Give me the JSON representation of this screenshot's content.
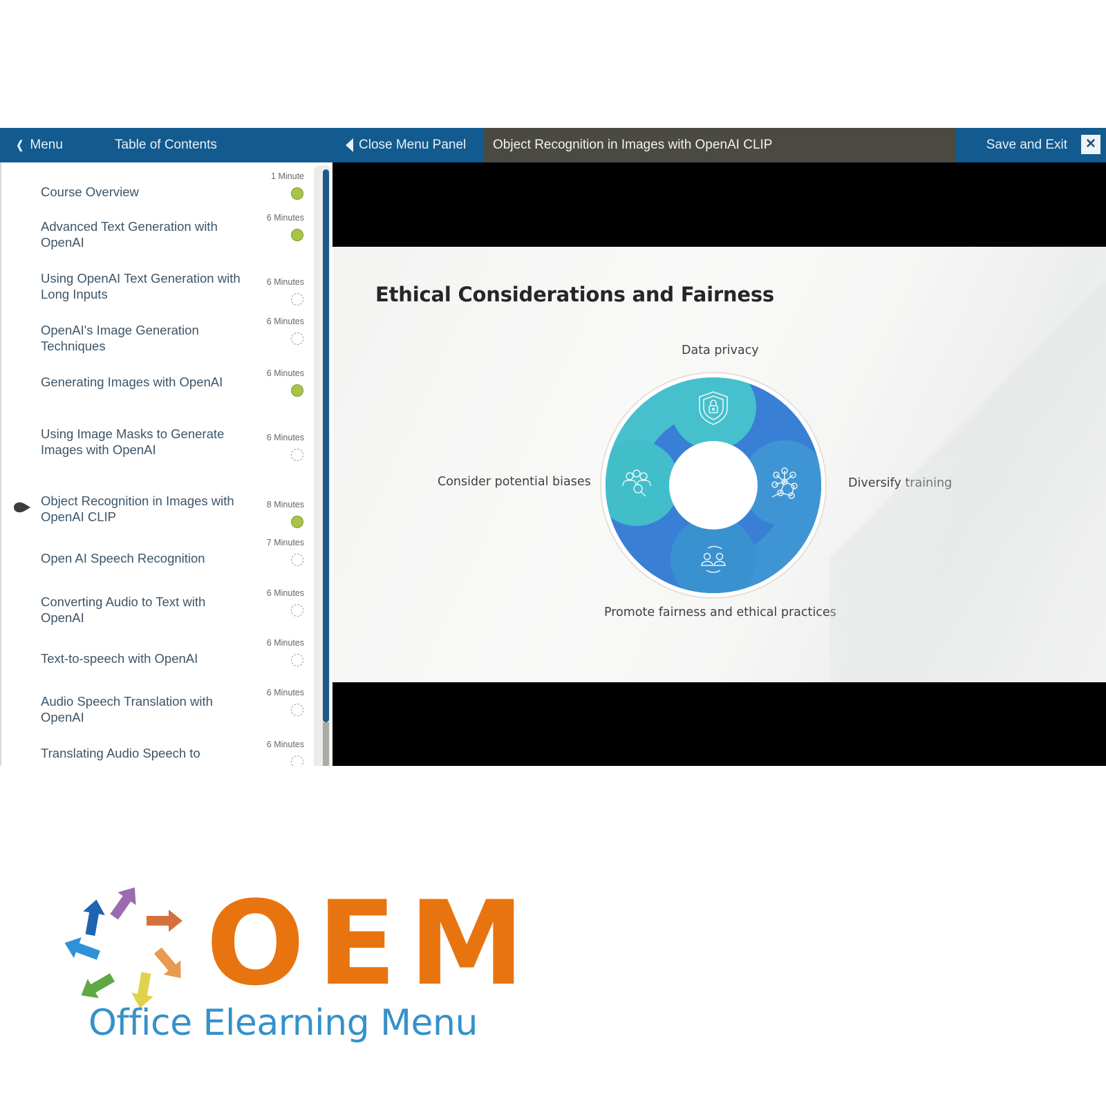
{
  "topbar": {
    "menu_label": "Menu",
    "toc_title": "Table of Contents",
    "close_panel_label": "Close Menu Panel",
    "lesson_title": "Object Recognition in Images with OpenAI CLIP",
    "save_exit_label": "Save and Exit",
    "close_glyph": "✕"
  },
  "toc": {
    "items": [
      {
        "title": "Course Overview",
        "duration": "1 Minute",
        "status": "completed",
        "current": false
      },
      {
        "title": "Advanced Text Generation with OpenAI",
        "duration": "6 Minutes",
        "status": "completed",
        "current": false
      },
      {
        "title": "Using OpenAI Text Generation with Long Inputs",
        "duration": "6 Minutes",
        "status": "not-started",
        "current": false
      },
      {
        "title": "OpenAI's Image Generation Techniques",
        "duration": "6 Minutes",
        "status": "not-started",
        "current": false
      },
      {
        "title": "Generating Images with OpenAI",
        "duration": "6 Minutes",
        "status": "completed",
        "current": false
      },
      {
        "title": "Using Image Masks to Generate Images with OpenAI",
        "duration": "6 Minutes",
        "status": "not-started",
        "current": false
      },
      {
        "title": "Object Recognition in Images with OpenAI CLIP",
        "duration": "8 Minutes",
        "status": "completed",
        "current": true
      },
      {
        "title": "Open AI Speech Recognition",
        "duration": "7 Minutes",
        "status": "not-started",
        "current": false
      },
      {
        "title": "Converting Audio to Text with OpenAI",
        "duration": "6 Minutes",
        "status": "not-started",
        "current": false
      },
      {
        "title": "Text-to-speech with OpenAI",
        "duration": "6 Minutes",
        "status": "not-started",
        "current": false
      },
      {
        "title": "Audio Speech Translation with OpenAI",
        "duration": "6 Minutes",
        "status": "not-started",
        "current": false
      },
      {
        "title": "Translating Audio Speech to",
        "duration": "6 Minutes",
        "status": "not-started",
        "current": false
      }
    ]
  },
  "slide": {
    "title": "Ethical Considerations and Fairness",
    "labels": {
      "top": "Data privacy",
      "right": "Diversify training",
      "bottom": "Promote fairness and ethical practices",
      "left": "Consider potential biases"
    },
    "segments": [
      {
        "name": "data-privacy",
        "icon": "shield-lock-icon",
        "color": "#46c0cc"
      },
      {
        "name": "diversify-training",
        "icon": "network-nodes-icon",
        "color": "#3f95d3"
      },
      {
        "name": "promote-fairness",
        "icon": "people-cycle-icon",
        "color": "#3a91cf"
      },
      {
        "name": "consider-biases",
        "icon": "people-search-icon",
        "color": "#42bdca"
      }
    ],
    "ring_color": "#3a7fd6"
  },
  "logo": {
    "wordmark": "OEM",
    "tagline": "Office Elearning Menu",
    "wordmark_color": "#e8740f",
    "tagline_color": "#3591c9",
    "arrow_colors": [
      "#1f64b3",
      "#9b6bb0",
      "#d4703c",
      "#e99a4f",
      "#e0d24a",
      "#5fa845",
      "#2e92d6"
    ]
  },
  "colors": {
    "toolbar_blue": "#135a8f",
    "toolbar_dark": "#4b4a42",
    "completed": "#a7c447",
    "toc_text": "#3c5569"
  }
}
